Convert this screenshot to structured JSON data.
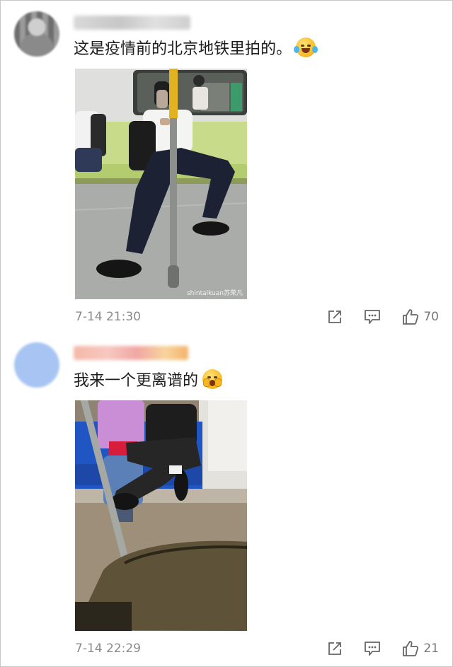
{
  "comments": [
    {
      "username": "",
      "text": "这是疫情前的北京地铁里拍的。",
      "emoji": "crying-laughing-emoji",
      "photo_watermark": "shintaikuan苏荣凡",
      "time": "7-14 21:30",
      "likes": "70"
    },
    {
      "username": "",
      "text": "我来一个更离谱的",
      "emoji": "screaming-emoji",
      "photo_watermark": "",
      "time": "7-14 22:29",
      "likes": "21"
    }
  ],
  "icons": {
    "share": "share-icon",
    "reply": "reply-icon",
    "like": "thumbs-up-icon"
  },
  "colors": {
    "meta_text": "#8a8a8a",
    "body_text": "#1e1e1e"
  }
}
